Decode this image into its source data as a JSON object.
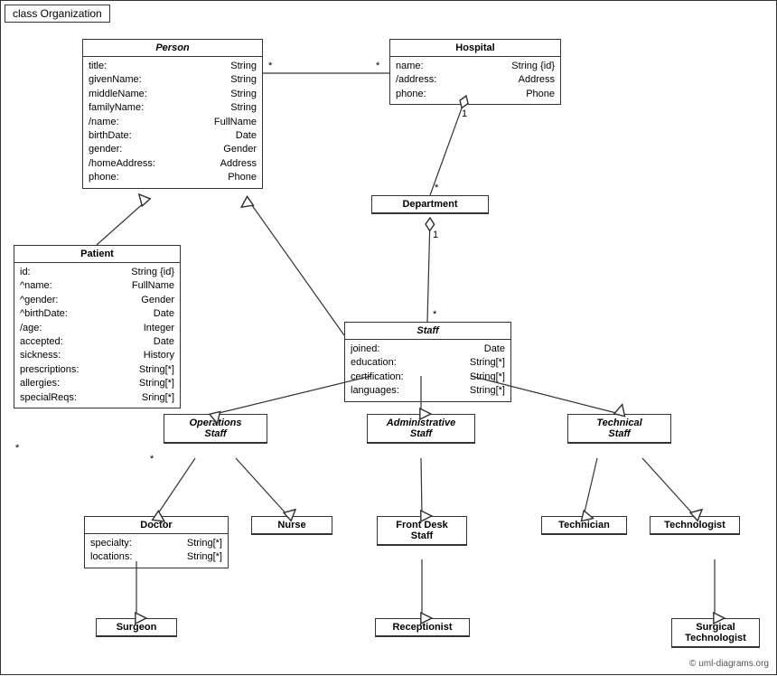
{
  "title": "class Organization",
  "copyright": "© uml-diagrams.org",
  "classes": {
    "person": {
      "name": "Person",
      "italic": true,
      "attrs": [
        [
          "title:",
          "String"
        ],
        [
          "givenName:",
          "String"
        ],
        [
          "middleName:",
          "String"
        ],
        [
          "familyName:",
          "String"
        ],
        [
          "/name:",
          "FullName"
        ],
        [
          "birthDate:",
          "Date"
        ],
        [
          "gender:",
          "Gender"
        ],
        [
          "/homeAddress:",
          "Address"
        ],
        [
          "phone:",
          "Phone"
        ]
      ]
    },
    "hospital": {
      "name": "Hospital",
      "italic": false,
      "attrs": [
        [
          "name:",
          "String {id}"
        ],
        [
          "/address:",
          "Address"
        ],
        [
          "phone:",
          "Phone"
        ]
      ]
    },
    "patient": {
      "name": "Patient",
      "italic": false,
      "attrs": [
        [
          "id:",
          "String {id}"
        ],
        [
          "^name:",
          "FullName"
        ],
        [
          "^gender:",
          "Gender"
        ],
        [
          "^birthDate:",
          "Date"
        ],
        [
          "/age:",
          "Integer"
        ],
        [
          "accepted:",
          "Date"
        ],
        [
          "sickness:",
          "History"
        ],
        [
          "prescriptions:",
          "String[*]"
        ],
        [
          "allergies:",
          "String[*]"
        ],
        [
          "specialReqs:",
          "Sring[*]"
        ]
      ]
    },
    "department": {
      "name": "Department",
      "italic": false,
      "attrs": []
    },
    "staff": {
      "name": "Staff",
      "italic": true,
      "attrs": [
        [
          "joined:",
          "Date"
        ],
        [
          "education:",
          "String[*]"
        ],
        [
          "certification:",
          "String[*]"
        ],
        [
          "languages:",
          "String[*]"
        ]
      ]
    },
    "operationsStaff": {
      "name": "Operations\nStaff",
      "italic": true,
      "attrs": []
    },
    "administrativeStaff": {
      "name": "Administrative\nStaff",
      "italic": true,
      "attrs": []
    },
    "technicalStaff": {
      "name": "Technical\nStaff",
      "italic": true,
      "attrs": []
    },
    "doctor": {
      "name": "Doctor",
      "italic": false,
      "attrs": [
        [
          "specialty:",
          "String[*]"
        ],
        [
          "locations:",
          "String[*]"
        ]
      ]
    },
    "nurse": {
      "name": "Nurse",
      "italic": false,
      "attrs": []
    },
    "frontDeskStaff": {
      "name": "Front Desk\nStaff",
      "italic": false,
      "attrs": []
    },
    "technician": {
      "name": "Technician",
      "italic": false,
      "attrs": []
    },
    "technologist": {
      "name": "Technologist",
      "italic": false,
      "attrs": []
    },
    "surgeon": {
      "name": "Surgeon",
      "italic": false,
      "attrs": []
    },
    "receptionist": {
      "name": "Receptionist",
      "italic": false,
      "attrs": []
    },
    "surgicalTechnologist": {
      "name": "Surgical\nTechnologist",
      "italic": false,
      "attrs": []
    }
  }
}
